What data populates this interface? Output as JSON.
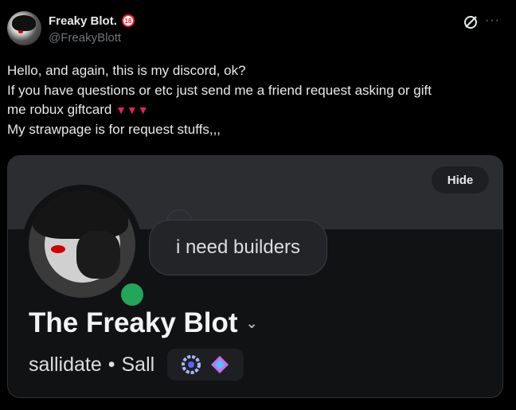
{
  "user": {
    "display_name": "Freaky Blot.",
    "age_badge": "18",
    "handle": "@FreakyBlott"
  },
  "tweet": {
    "lines": [
      "Hello, and again, this is my discord, ok?",
      "If you have questions or etc just send me a friend request asking or gift",
      "me robux giftcard",
      "My strawpage is for request stuffs,,,"
    ]
  },
  "card": {
    "hide_label": "Hide",
    "status_text": "i need builders",
    "server_name": "The Freaky Blot",
    "username": "sallidate",
    "separator": "•",
    "nickname": "Sall",
    "online_color": "#23a55a"
  },
  "icons": [
    "grok-icon",
    "more-icon",
    "tongue-icon",
    "chevron-down-icon",
    "badge-icon"
  ]
}
